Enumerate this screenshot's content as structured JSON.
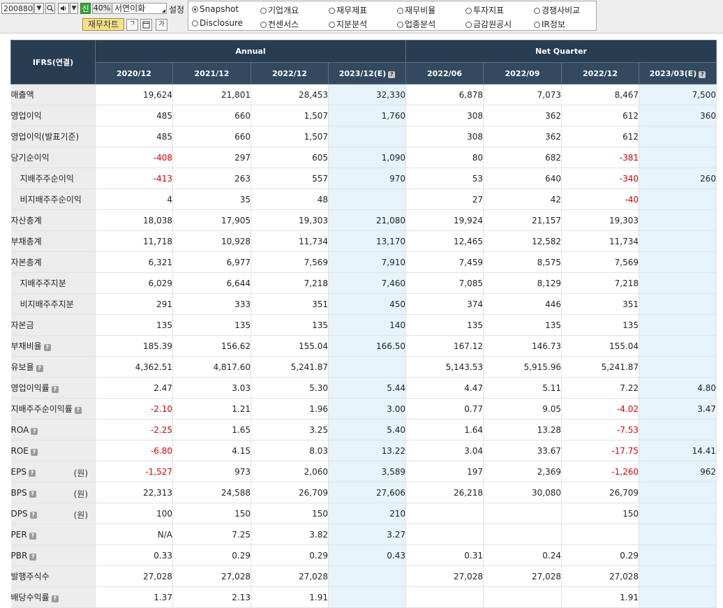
{
  "toolbar": {
    "stock_code": "200880",
    "sin_badge": "신",
    "percent": "40%",
    "company_name": "서연이화",
    "setting_label": "설정",
    "chart_button": "재무차트",
    "radio_options": [
      {
        "label": "Snapshot",
        "checked": true
      },
      {
        "label": "기업개요",
        "checked": false
      },
      {
        "label": "재무제표",
        "checked": false
      },
      {
        "label": "재무비율",
        "checked": false
      },
      {
        "label": "투자지표",
        "checked": false
      },
      {
        "label": "경쟁사비교",
        "checked": false
      },
      {
        "label": "Disclosure",
        "checked": false
      },
      {
        "label": "컨센서스",
        "checked": false
      },
      {
        "label": "지분분석",
        "checked": false
      },
      {
        "label": "업종분석",
        "checked": false
      },
      {
        "label": "금감원공시",
        "checked": false
      },
      {
        "label": "IR정보",
        "checked": false
      }
    ]
  },
  "table": {
    "corner_header": "IFRS(연결)",
    "group_annual": "Annual",
    "group_quarter": "Net Quarter",
    "periods": [
      "2020/12",
      "2021/12",
      "2022/12",
      "2023/12(E)",
      "2022/06",
      "2022/09",
      "2022/12",
      "2023/03(E)"
    ],
    "estimate_columns": [
      3,
      7
    ],
    "rows": [
      {
        "label": "매출액",
        "indent": false,
        "help": false,
        "unit": "",
        "values": [
          "19,624",
          "21,801",
          "28,453",
          "32,330",
          "6,878",
          "7,073",
          "8,467",
          "7,500"
        ]
      },
      {
        "label": "영업이익",
        "indent": false,
        "help": false,
        "unit": "",
        "values": [
          "485",
          "660",
          "1,507",
          "1,760",
          "308",
          "362",
          "612",
          "360"
        ]
      },
      {
        "label": "영업이익(발표기준)",
        "indent": false,
        "help": false,
        "unit": "",
        "values": [
          "485",
          "660",
          "1,507",
          "",
          "308",
          "362",
          "612",
          ""
        ]
      },
      {
        "label": "당기순이익",
        "indent": false,
        "help": false,
        "unit": "",
        "values": [
          "-408",
          "297",
          "605",
          "1,090",
          "80",
          "682",
          "-381",
          ""
        ]
      },
      {
        "label": "지배주주순이익",
        "indent": true,
        "help": false,
        "unit": "",
        "values": [
          "-413",
          "263",
          "557",
          "970",
          "53",
          "640",
          "-340",
          "260"
        ]
      },
      {
        "label": "비지배주주순이익",
        "indent": true,
        "help": false,
        "unit": "",
        "values": [
          "4",
          "35",
          "48",
          "",
          "27",
          "42",
          "-40",
          ""
        ]
      },
      {
        "label": "자산총계",
        "indent": false,
        "help": false,
        "unit": "",
        "values": [
          "18,038",
          "17,905",
          "19,303",
          "21,080",
          "19,924",
          "21,157",
          "19,303",
          ""
        ]
      },
      {
        "label": "부채총계",
        "indent": false,
        "help": false,
        "unit": "",
        "values": [
          "11,718",
          "10,928",
          "11,734",
          "13,170",
          "12,465",
          "12,582",
          "11,734",
          ""
        ]
      },
      {
        "label": "자본총계",
        "indent": false,
        "help": false,
        "unit": "",
        "values": [
          "6,321",
          "6,977",
          "7,569",
          "7,910",
          "7,459",
          "8,575",
          "7,569",
          ""
        ]
      },
      {
        "label": "지배주주지분",
        "indent": true,
        "help": false,
        "unit": "",
        "values": [
          "6,029",
          "6,644",
          "7,218",
          "7,460",
          "7,085",
          "8,129",
          "7,218",
          ""
        ]
      },
      {
        "label": "비지배주주지분",
        "indent": true,
        "help": false,
        "unit": "",
        "values": [
          "291",
          "333",
          "351",
          "450",
          "374",
          "446",
          "351",
          ""
        ]
      },
      {
        "label": "자본금",
        "indent": false,
        "help": false,
        "unit": "",
        "values": [
          "135",
          "135",
          "135",
          "140",
          "135",
          "135",
          "135",
          ""
        ]
      },
      {
        "label": "부채비율",
        "indent": false,
        "help": true,
        "unit": "",
        "values": [
          "185.39",
          "156.62",
          "155.04",
          "166.50",
          "167.12",
          "146.73",
          "155.04",
          ""
        ]
      },
      {
        "label": "유보율",
        "indent": false,
        "help": true,
        "unit": "",
        "values": [
          "4,362.51",
          "4,817.60",
          "5,241.87",
          "",
          "5,143.53",
          "5,915.96",
          "5,241.87",
          ""
        ]
      },
      {
        "label": "영업이익률",
        "indent": false,
        "help": true,
        "unit": "",
        "values": [
          "2.47",
          "3.03",
          "5.30",
          "5.44",
          "4.47",
          "5.11",
          "7.22",
          "4.80"
        ]
      },
      {
        "label": "지배주주순이익률",
        "indent": false,
        "help": true,
        "unit": "",
        "values": [
          "-2.10",
          "1.21",
          "1.96",
          "3.00",
          "0.77",
          "9.05",
          "-4.02",
          "3.47"
        ]
      },
      {
        "label": "ROA",
        "indent": false,
        "help": true,
        "unit": "",
        "values": [
          "-2.25",
          "1.65",
          "3.25",
          "5.40",
          "1.64",
          "13.28",
          "-7.53",
          ""
        ]
      },
      {
        "label": "ROE",
        "indent": false,
        "help": true,
        "unit": "",
        "values": [
          "-6.80",
          "4.15",
          "8.03",
          "13.22",
          "3.04",
          "33.67",
          "-17.75",
          "14.41"
        ]
      },
      {
        "label": "EPS",
        "indent": false,
        "help": true,
        "unit": "(원)",
        "values": [
          "-1,527",
          "973",
          "2,060",
          "3,589",
          "197",
          "2,369",
          "-1,260",
          "962"
        ]
      },
      {
        "label": "BPS",
        "indent": false,
        "help": true,
        "unit": "(원)",
        "values": [
          "22,313",
          "24,588",
          "26,709",
          "27,606",
          "26,218",
          "30,080",
          "26,709",
          ""
        ]
      },
      {
        "label": "DPS",
        "indent": false,
        "help": true,
        "unit": "(원)",
        "values": [
          "100",
          "150",
          "150",
          "210",
          "",
          "",
          "150",
          ""
        ]
      },
      {
        "label": "PER",
        "indent": false,
        "help": true,
        "unit": "",
        "values": [
          "N/A",
          "7.25",
          "3.82",
          "3.27",
          "",
          "",
          "",
          ""
        ]
      },
      {
        "label": "PBR",
        "indent": false,
        "help": true,
        "unit": "",
        "values": [
          "0.33",
          "0.29",
          "0.29",
          "0.43",
          "0.31",
          "0.24",
          "0.29",
          ""
        ]
      },
      {
        "label": "발행주식수",
        "indent": false,
        "help": false,
        "unit": "",
        "values": [
          "27,028",
          "27,028",
          "27,028",
          "",
          "27,028",
          "27,028",
          "27,028",
          ""
        ]
      },
      {
        "label": "배당수익률",
        "indent": false,
        "help": true,
        "unit": "",
        "values": [
          "1.37",
          "2.13",
          "1.91",
          "",
          "",
          "",
          "1.91",
          ""
        ]
      }
    ]
  },
  "icons": {
    "dropdown": "chevron-down-icon",
    "search": "search-icon",
    "speaker": "speaker-icon",
    "help": "help-icon"
  }
}
